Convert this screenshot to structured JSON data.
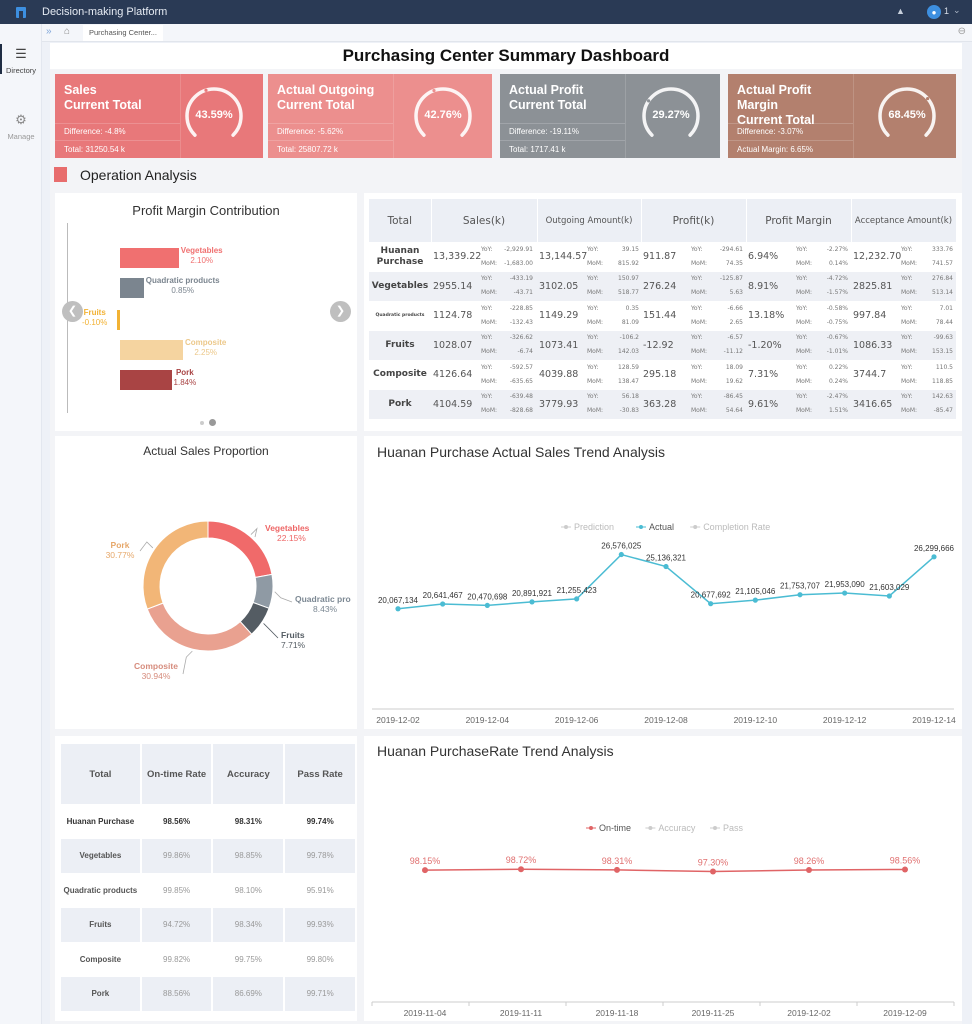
{
  "app": {
    "title": "Decision-making Platform",
    "user": "1",
    "icons": {
      "logo": "app-logo",
      "bell": "bell-icon",
      "user": "user-icon",
      "caret": "chevron-down-icon"
    }
  },
  "sidebar": {
    "items": [
      {
        "label": "Directory",
        "icon": "list-icon",
        "active": true
      },
      {
        "label": "Manage",
        "icon": "gear-icon",
        "active": false
      }
    ]
  },
  "tabbar": {
    "tabs": [
      {
        "label": "Purchasing Center..."
      }
    ]
  },
  "page": {
    "title": "Purchasing Center Summary Dashboard",
    "section_title": "Operation Analysis"
  },
  "kpis": [
    {
      "title_line1": "Sales",
      "title_line2": "Current Total",
      "difference": "Difference: -4.8%",
      "total": "Total: 31250.54 k",
      "percent_label": "43.59%",
      "percent": 43.59,
      "color": "#e8787a"
    },
    {
      "title_line1": "Actual Outgoing",
      "title_line2": "Current Total",
      "difference": "Difference: -5.62%",
      "total": "Total: 25807.72 k",
      "percent_label": "42.76%",
      "percent": 42.76,
      "color": "#ec8f8e"
    },
    {
      "title_line1": "Actual Profit",
      "title_line2": "Current Total",
      "difference": "Difference: -19.11%",
      "total": "Total: 1717.41 k",
      "percent_label": "29.27%",
      "percent": 29.27,
      "color": "#8c9196"
    },
    {
      "title_line1": "Actual Profit Margin",
      "title_line2": "Current Total",
      "difference": "Difference: -3.07%",
      "total": "Actual Margin: 6.65%",
      "percent_label": "68.45%",
      "percent": 68.45,
      "color": "#b3806e"
    }
  ],
  "profit_margin": {
    "title": "Profit Margin Contribution",
    "items": [
      {
        "name": "Vegetables",
        "label": "2.10%",
        "value": 2.1,
        "color": "#f07070"
      },
      {
        "name": "Quadratic products",
        "label": "0.85%",
        "value": 0.85,
        "color": "#7b858f"
      },
      {
        "name": "Fruits",
        "label": "-0.10%",
        "value": -0.1,
        "color": "#f2b234"
      },
      {
        "name": "Composite",
        "label": "2.25%",
        "value": 2.25,
        "color": "#f5d4a0"
      },
      {
        "name": "Pork",
        "label": "1.84%",
        "value": 1.84,
        "color": "#a94444"
      }
    ],
    "prev_icon": "chevron-left-icon",
    "next_icon": "chevron-right-icon",
    "pages": 2,
    "current_page": 2
  },
  "summary_table": {
    "headers": [
      "Total",
      "Sales(k)",
      "Outgoing Amount(k)",
      "Profit(k)",
      "Profit Margin",
      "Acceptance Amount(k)"
    ],
    "yoy_label": "YoY:",
    "mom_label": "MoM:",
    "rows": [
      {
        "name": "Huanan Purchase",
        "cells": [
          {
            "value": "13,339.22",
            "yoy": "-2,929.91",
            "mom": "-1,683.00"
          },
          {
            "value": "13,144.57",
            "yoy": "39.15",
            "mom": "815.92"
          },
          {
            "value": "911.87",
            "yoy": "-294.61",
            "mom": "74.35"
          },
          {
            "value": "6.94%",
            "yoy": "-2.27%",
            "mom": "0.14%"
          },
          {
            "value": "12,232.70",
            "yoy": "333.76",
            "mom": "741.57"
          }
        ]
      },
      {
        "name": "Vegetables",
        "cells": [
          {
            "value": "2955.14",
            "yoy": "-433.19",
            "mom": "-43.71"
          },
          {
            "value": "3102.05",
            "yoy": "150.97",
            "mom": "518.77"
          },
          {
            "value": "276.24",
            "yoy": "-125.87",
            "mom": "5.63"
          },
          {
            "value": "8.91%",
            "yoy": "-4.72%",
            "mom": "-1.57%"
          },
          {
            "value": "2825.81",
            "yoy": "276.84",
            "mom": "513.14"
          }
        ]
      },
      {
        "name": "Quadratic products",
        "cells": [
          {
            "value": "1124.78",
            "yoy": "-228.85",
            "mom": "-132.43"
          },
          {
            "value": "1149.29",
            "yoy": "0.35",
            "mom": "81.09"
          },
          {
            "value": "151.44",
            "yoy": "-6.66",
            "mom": "2.65"
          },
          {
            "value": "13.18%",
            "yoy": "-0.58%",
            "mom": "-0.75%"
          },
          {
            "value": "997.84",
            "yoy": "7.01",
            "mom": "78.44"
          }
        ]
      },
      {
        "name": "Fruits",
        "cells": [
          {
            "value": "1028.07",
            "yoy": "-326.62",
            "mom": "-6.74"
          },
          {
            "value": "1073.41",
            "yoy": "-106.2",
            "mom": "142.03"
          },
          {
            "value": "-12.92",
            "yoy": "-6.57",
            "mom": "-11.12"
          },
          {
            "value": "-1.20%",
            "yoy": "-0.67%",
            "mom": "-1.01%"
          },
          {
            "value": "1086.33",
            "yoy": "-99.63",
            "mom": "153.15"
          }
        ]
      },
      {
        "name": "Composite",
        "cells": [
          {
            "value": "4126.64",
            "yoy": "-592.57",
            "mom": "-635.65"
          },
          {
            "value": "4039.88",
            "yoy": "128.59",
            "mom": "138.47"
          },
          {
            "value": "295.18",
            "yoy": "18.09",
            "mom": "19.62"
          },
          {
            "value": "7.31%",
            "yoy": "0.22%",
            "mom": "0.24%"
          },
          {
            "value": "3744.7",
            "yoy": "110.5",
            "mom": "118.85"
          }
        ]
      },
      {
        "name": "Pork",
        "cells": [
          {
            "value": "4104.59",
            "yoy": "-639.48",
            "mom": "-828.68"
          },
          {
            "value": "3779.93",
            "yoy": "56.18",
            "mom": "-30.83"
          },
          {
            "value": "363.28",
            "yoy": "-86.45",
            "mom": "54.64"
          },
          {
            "value": "9.61%",
            "yoy": "-2.47%",
            "mom": "1.51%"
          },
          {
            "value": "3416.65",
            "yoy": "142.63",
            "mom": "-85.47"
          }
        ]
      }
    ]
  },
  "rate_table": {
    "headers": [
      "Total",
      "On-time Rate",
      "Accuracy",
      "Pass Rate"
    ],
    "rows": [
      {
        "name": "Huanan Purchase",
        "values": [
          "98.56%",
          "98.31%",
          "99.74%"
        ]
      },
      {
        "name": "Vegetables",
        "values": [
          "99.86%",
          "98.85%",
          "99.78%"
        ]
      },
      {
        "name": "Quadratic products",
        "values": [
          "99.85%",
          "98.10%",
          "95.91%"
        ]
      },
      {
        "name": "Fruits",
        "values": [
          "94.72%",
          "98.34%",
          "99.93%"
        ]
      },
      {
        "name": "Composite",
        "values": [
          "99.82%",
          "99.75%",
          "99.80%"
        ]
      },
      {
        "name": "Pork",
        "values": [
          "88.56%",
          "86.69%",
          "99.71%"
        ]
      }
    ]
  },
  "chart_data": [
    {
      "type": "bar",
      "title": "Profit Margin Contribution",
      "orientation": "horizontal",
      "categories": [
        "Vegetables",
        "Quadratic products",
        "Fruits",
        "Composite",
        "Pork"
      ],
      "values": [
        2.1,
        0.85,
        -0.1,
        2.25,
        1.84
      ],
      "unit": "%"
    },
    {
      "type": "pie",
      "title": "Actual Sales Proportion",
      "donut": true,
      "categories": [
        "Vegetables",
        "Quadratic products",
        "Fruits",
        "Composite",
        "Pork"
      ],
      "display_labels": [
        "Vegetables",
        "Quadratic pro",
        "Fruits",
        "Composite",
        "Pork"
      ],
      "values": [
        22.15,
        8.43,
        7.71,
        30.94,
        30.77
      ],
      "colors": [
        "#f06a6a",
        "#8f9aa4",
        "#545c63",
        "#e9a190",
        "#f2b677"
      ],
      "unit": "%"
    },
    {
      "type": "line",
      "title": "Huanan Purchase Actual Sales Trend Analysis",
      "legend": [
        {
          "name": "Prediction",
          "active": false
        },
        {
          "name": "Actual",
          "active": true
        },
        {
          "name": "Completion Rate",
          "active": false
        }
      ],
      "legend_position": "top-center",
      "x": [
        "2019-12-02",
        "2019-12-03",
        "2019-12-04",
        "2019-12-05",
        "2019-12-06",
        "2019-12-07",
        "2019-12-08",
        "2019-12-09",
        "2019-12-10",
        "2019-12-11",
        "2019-12-12",
        "2019-12-13",
        "2019-12-14"
      ],
      "x_tick_labels": [
        "2019-12-02",
        "2019-12-04",
        "2019-12-06",
        "2019-12-08",
        "2019-12-10",
        "2019-12-12",
        "2019-12-14"
      ],
      "series": [
        {
          "name": "Actual",
          "color": "#4bbcd3",
          "values": [
            20067134,
            20641467,
            20470698,
            20891921,
            21255423,
            26576025,
            25136321,
            20677692,
            21105046,
            21753707,
            21953090,
            21603029,
            26299666
          ],
          "labels": [
            "20,067,134",
            "20,641,467",
            "20,470,698",
            "20,891,921",
            "21,255,423",
            "26,576,025",
            "25,136,321",
            "20,677,692",
            "21,105,046",
            "21,753,707",
            "21,953,090",
            "21,603,029",
            "26,299,666"
          ]
        }
      ],
      "ylim": [
        12000000,
        30000000
      ],
      "grid": false
    },
    {
      "type": "line",
      "title": "Huanan PurchaseRate Trend Analysis",
      "legend": [
        {
          "name": "On-time",
          "active": true
        },
        {
          "name": "Accuracy",
          "active": false
        },
        {
          "name": "Pass",
          "active": false
        }
      ],
      "legend_position": "top-center",
      "x": [
        "2019-11-04",
        "2019-11-11",
        "2019-11-18",
        "2019-11-25",
        "2019-12-02",
        "2019-12-09"
      ],
      "series": [
        {
          "name": "On-time",
          "color": "#e06466",
          "values": [
            98.15,
            98.72,
            98.31,
            97.3,
            98.26,
            98.56
          ],
          "labels": [
            "98.15%",
            "98.72%",
            "98.31%",
            "97.30%",
            "98.26%",
            "98.56%"
          ]
        }
      ],
      "ylim": [
        0,
        180
      ],
      "grid": false
    }
  ]
}
